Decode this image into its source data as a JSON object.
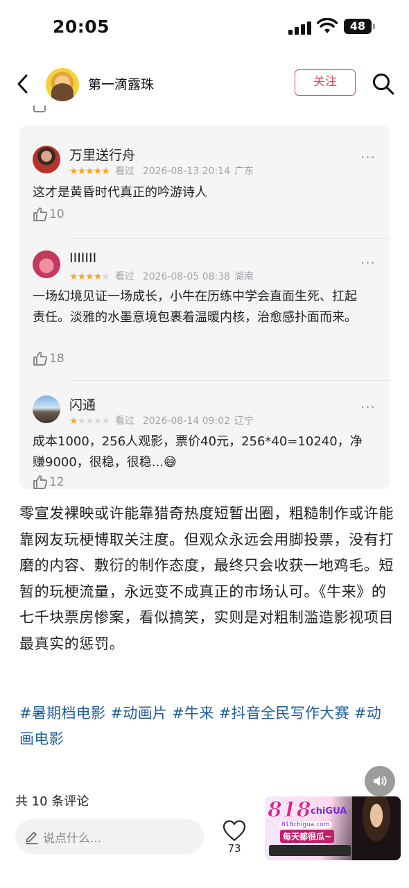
{
  "status_bar": {
    "time": "20:05",
    "battery": "48"
  },
  "nav": {
    "title": "第一滴露珠",
    "follow_label": "关注"
  },
  "comments": [
    {
      "name": "万里送行舟",
      "stars": 5,
      "seen": "看过",
      "timestamp": "2026-08-13 20:14",
      "location": "广东",
      "text": "这才是黄昏时代真正的吟游诗人",
      "likes": "10",
      "more": "···"
    },
    {
      "name": "IIIIIII",
      "stars": 4,
      "seen": "看过",
      "timestamp": "2026-08-05 08:38",
      "location": "湖南",
      "text": "一场幻境见证一场成长，小牛在历练中学会直面生死、扛起责任。淡雅的水墨意境包裹着温暖内核，治愈感扑面而来。",
      "likes": "18",
      "more": "···"
    },
    {
      "name": "闪通",
      "stars": 1,
      "seen": "看过",
      "timestamp": "2026-08-14 09:02",
      "location": "辽宁",
      "text": "成本1000，256人观影，票价40元，256*40=10240，净赚9000，很稳，很稳...😅",
      "likes": "12",
      "more": "···"
    }
  ],
  "article": {
    "body": "零宣发裸映或许能靠猎奇热度短暂出圈，粗糙制作或许能靠网友玩梗博取关注度。但观众永远会用脚投票，没有打磨的内容、敷衍的制作态度，最终只会收获一地鸡毛。短暂的玩梗流量，永远变不成真正的市场认可。《牛来》的七千块票房惨案，看似搞笑，实则是对粗制滥造影视项目最真实的惩罚。",
    "tags": "#暑期档电影 #动画片 #牛来 #抖音全民写作大赛 #动画电影"
  },
  "footer": {
    "comment_count": "共 10 条评论",
    "input_placeholder": "说点什么...",
    "like_count": "73"
  },
  "ad": {
    "logo": "818",
    "logo_suffix": "chiGUA",
    "url": "818chigua.com",
    "slogan": "每天都很瓜~"
  },
  "colors": {
    "accent": "#e8445a",
    "tag_link": "#1f5d9a",
    "star_on": "#f5a623",
    "star_off": "#d6d6d9"
  }
}
